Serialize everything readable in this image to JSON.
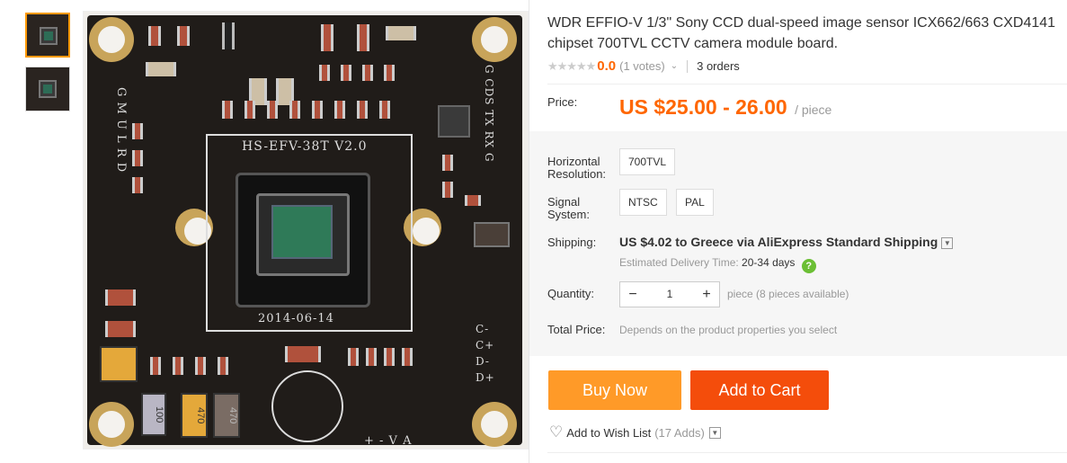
{
  "gallery": {
    "thumbnails": [
      {
        "label": "thumbnail-1",
        "selected": true
      },
      {
        "label": "thumbnail-2",
        "selected": false
      }
    ],
    "main_image": {
      "board_silkscreen": "HS-EFV-38T V2.0",
      "date_print": "2014-06-14",
      "left_pins": "G M U L R D",
      "right_pins": "G CDS TX RX G",
      "bottom_pins": "+ - V A",
      "side_pins": "C- C+ D- D+",
      "cap_label_1": "100",
      "cap_label_2": "470",
      "cap_label_3": "470"
    }
  },
  "product": {
    "title": "WDR EFFIO-V 1/3\" Sony CCD dual-speed image sensor ICX662/663 CXD4141 chipset 700TVL CCTV camera module board.",
    "rating": {
      "stars": "★★★★★",
      "value": "0.0",
      "votes": "(1 votes)",
      "orders": "3 orders"
    },
    "price": {
      "label": "Price:",
      "value": "US $25.00 - 26.00",
      "unit": "/ piece"
    },
    "properties": {
      "resolution_label": "Horizontal Resolution:",
      "resolution_options": [
        "700TVL"
      ],
      "signal_label": "Signal System:",
      "signal_options": [
        "NTSC",
        "PAL"
      ],
      "shipping_label": "Shipping:",
      "shipping_main": "US $4.02 to Greece via AliExpress Standard Shipping",
      "delivery_label": "Estimated Delivery Time:",
      "delivery_days": "20-34 days",
      "help_glyph": "?",
      "quantity_label": "Quantity:",
      "quantity_minus": "−",
      "quantity_value": "1",
      "quantity_plus": "+",
      "quantity_note": "piece (8 pieces available)",
      "total_label": "Total Price:",
      "total_value": "Depends on the product properties you select"
    },
    "actions": {
      "buy_now": "Buy Now",
      "add_to_cart": "Add to Cart",
      "wish_label": "Add to Wish List",
      "wish_count": "(17 Adds)"
    }
  },
  "colors": {
    "accent": "#ff6600",
    "buy_now": "#ff9a28",
    "add_to_cart": "#f44d0b",
    "help_green": "#6bbf34"
  },
  "icons": [
    "star-icon",
    "chevron-down-icon",
    "help-icon",
    "minus-icon",
    "plus-icon",
    "heart-icon"
  ]
}
